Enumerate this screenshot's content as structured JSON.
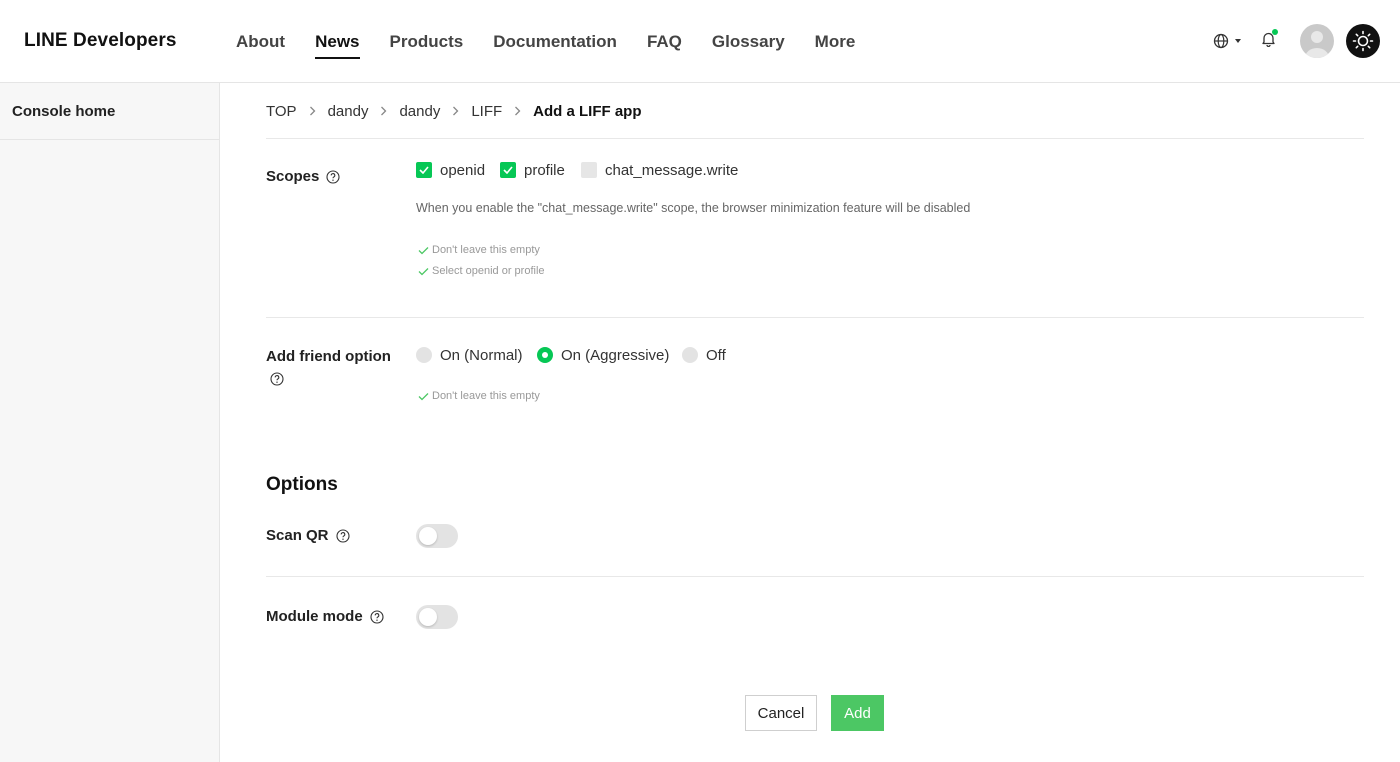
{
  "header": {
    "logo": "LINE Developers",
    "nav": [
      "About",
      "News",
      "Products",
      "Documentation",
      "FAQ",
      "Glossary",
      "More"
    ],
    "active_nav": "News"
  },
  "sidebar": {
    "items": [
      {
        "label": "Console home"
      }
    ]
  },
  "breadcrumb": [
    "TOP",
    "dandy",
    "dandy",
    "LIFF",
    "Add a LIFF app"
  ],
  "scopes": {
    "label": "Scopes",
    "options": [
      {
        "label": "openid",
        "checked": true
      },
      {
        "label": "profile",
        "checked": true
      },
      {
        "label": "chat_message.write",
        "checked": false
      }
    ],
    "note": "When you enable the \"chat_message.write\" scope, the browser minimization feature will be disabled",
    "validations": [
      "Don't leave this empty",
      "Select openid or profile"
    ]
  },
  "add_friend": {
    "label": "Add friend option",
    "options": [
      {
        "label": "On (Normal)",
        "selected": false
      },
      {
        "label": "On (Aggressive)",
        "selected": true
      },
      {
        "label": "Off",
        "selected": false
      }
    ],
    "validation": "Don't leave this empty"
  },
  "options_section": {
    "title": "Options",
    "scan_qr": {
      "label": "Scan QR",
      "enabled": false
    },
    "module_mode": {
      "label": "Module mode",
      "enabled": false
    }
  },
  "actions": {
    "cancel": "Cancel",
    "add": "Add"
  },
  "colors": {
    "accent": "#06c755",
    "add_button": "#4cc764"
  }
}
